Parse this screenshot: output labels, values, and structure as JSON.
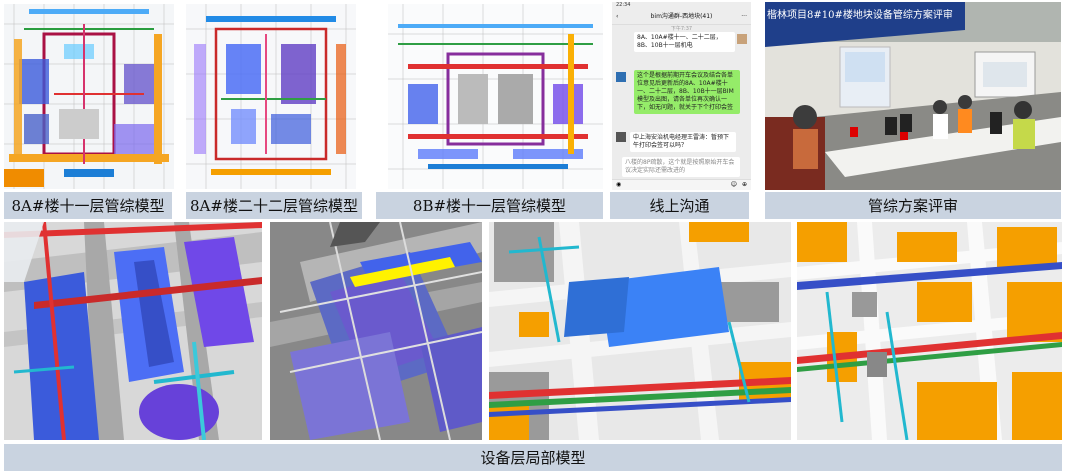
{
  "captions": {
    "top": [
      "8A#楼十一层管综模型",
      "8A#楼二十二层管综模型",
      "8B#楼十一层管综模型",
      "线上沟通",
      "管综方案评审"
    ],
    "bottom": "设备层局部模型"
  },
  "chat": {
    "time": "22:34",
    "title": "bim沟通群-西地块(41)",
    "timestamp1": "下午7:37",
    "msg1": "8A、10A#楼十一、二十二层，8B、10B十一层机电",
    "msg2": "这个是根据前期开车会议及结合各单位意见后更新后的8A、10A#楼十一、二十二层，8B、10B十一层BIM模型及出图，请各单位再次确认一下，如无问题，就关于下个打印会签",
    "msg3": "中上海安治机电经理王雷涛：暂预下午打印会签可以吗？",
    "msg4": "八楼的8P疏散，这个就是按照原始开车会议决定实际还需改进的"
  },
  "review_banner": "楷林项目8#10#楼地块设备管综方案评审"
}
